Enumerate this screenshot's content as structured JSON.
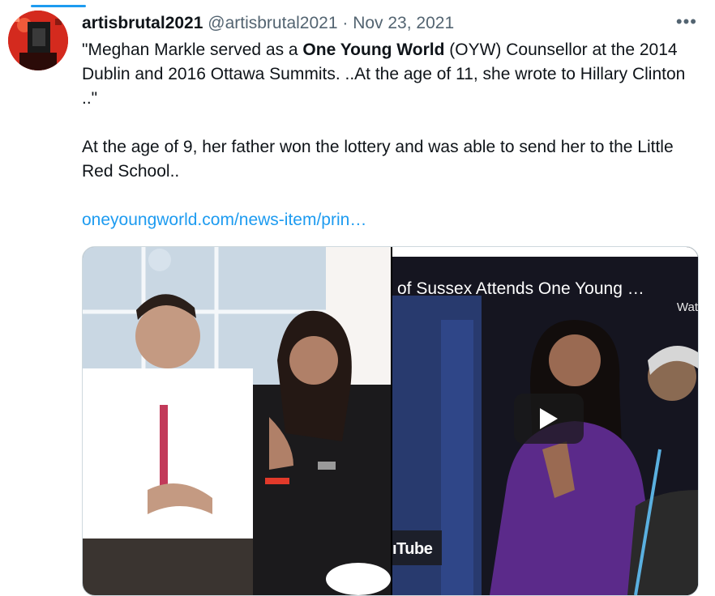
{
  "tweet": {
    "display_name": "artisbrutal2021",
    "handle": "@artisbrutal2021",
    "separator": "·",
    "date": "Nov 23, 2021",
    "more_label": "•••",
    "text_line1_before": "\"Meghan Markle served as a ",
    "text_line1_bold": "One Young World",
    "text_line1_after": " (OYW) Counsellor at the 2014 Dublin and 2016 Ottawa Summits. ..At the age of 11, she wrote to Hillary Clinton ..\"",
    "text_line2": "At the age of 9, her father won the lottery and was able to send her to the Little Red School..",
    "link": "oneyoungworld.com/news-item/prin…"
  },
  "media": {
    "video_title": "of Sussex Attends One Young …",
    "watch_label": "Wat",
    "platform_label": "ıTube"
  },
  "colors": {
    "accent": "#1d9bf0",
    "secondary_text": "#536471"
  }
}
